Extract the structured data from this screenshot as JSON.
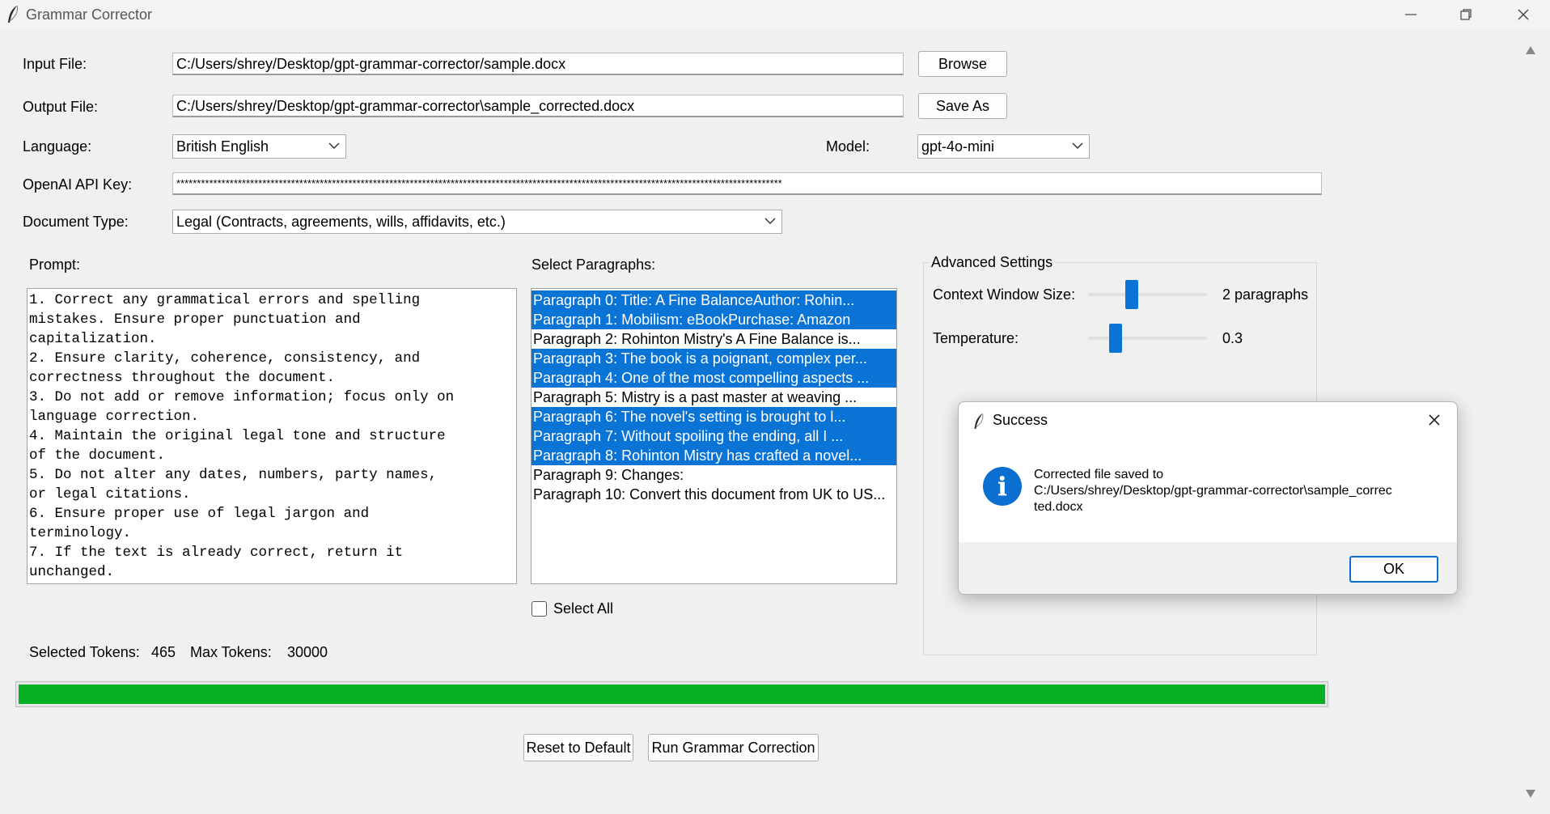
{
  "window": {
    "title": "Grammar Corrector"
  },
  "form": {
    "input_file_label": "Input File:",
    "input_file_value": "C:/Users/shrey/Desktop/gpt-grammar-corrector/sample.docx",
    "browse_label": "Browse",
    "output_file_label": "Output File:",
    "output_file_value": "C:/Users/shrey/Desktop/gpt-grammar-corrector\\sample_corrected.docx",
    "save_as_label": "Save As",
    "language_label": "Language:",
    "language_value": "British English",
    "model_label": "Model:",
    "model_value": "gpt-4o-mini",
    "api_key_label": "OpenAI API Key:",
    "api_key_value": "****************************************************************************************************************************************************",
    "doc_type_label": "Document Type:",
    "doc_type_value": "Legal (Contracts, agreements, wills, affidavits, etc.)"
  },
  "prompt": {
    "label": "Prompt:",
    "text": "1. Correct any grammatical errors and spelling\nmistakes. Ensure proper punctuation and\ncapitalization.\n2. Ensure clarity, coherence, consistency, and\ncorrectness throughout the document.\n3. Do not add or remove information; focus only on\nlanguage correction.\n4. Maintain the original legal tone and structure\nof the document.\n5. Do not alter any dates, numbers, party names,\nor legal citations.\n6. Ensure proper use of legal jargon and\nterminology.\n7. If the text is already correct, return it\nunchanged."
  },
  "paragraphs": {
    "label": "Select Paragraphs:",
    "items": [
      {
        "text": "Paragraph 0: Title: A Fine BalanceAuthor: Rohin...",
        "selected": true
      },
      {
        "text": "Paragraph 1: Mobilism: eBookPurchase: Amazon",
        "selected": true
      },
      {
        "text": "Paragraph 2: Rohinton Mistry's A Fine Balance is...",
        "selected": false
      },
      {
        "text": "Paragraph 3: The book is a poignant, complex per...",
        "selected": true
      },
      {
        "text": "Paragraph 4: One of the most compelling aspects ...",
        "selected": true
      },
      {
        "text": "Paragraph 5: Mistry is a past master at weaving ...",
        "selected": false
      },
      {
        "text": "Paragraph 6: The novel's setting is brought to l...",
        "selected": true
      },
      {
        "text": "Paragraph 7: Without spoiling the ending, all I ...",
        "selected": true
      },
      {
        "text": "Paragraph 8: Rohinton Mistry has crafted a novel...",
        "selected": true
      },
      {
        "text": "Paragraph 9: Changes:",
        "selected": false
      },
      {
        "text": "Paragraph 10: Convert this document from UK to US...",
        "selected": false
      }
    ],
    "select_all_label": "Select All",
    "select_all_checked": false
  },
  "advanced": {
    "title": "Advanced Settings",
    "context_label": "Context Window Size:",
    "context_value": "2 paragraphs",
    "context_fraction": 0.35,
    "temperature_label": "Temperature:",
    "temperature_value": "0.3",
    "temperature_fraction": 0.2
  },
  "tokens": {
    "selected_label": "Selected Tokens:",
    "selected_value": "465",
    "max_label": "Max Tokens:",
    "max_value": "30000"
  },
  "progress": {
    "percent": 100,
    "color": "#06b025"
  },
  "actions": {
    "reset_label": "Reset to Default",
    "run_label": "Run Grammar Correction"
  },
  "dialog": {
    "title": "Success",
    "message_line1": "Corrected file saved to",
    "message_line2": "C:/Users/shrey/Desktop/gpt-grammar-corrector\\sample_correc",
    "message_line3": "ted.docx",
    "ok_label": "OK",
    "icon": "info-icon"
  },
  "colors": {
    "accent": "#0a74d6",
    "progress": "#06b025"
  }
}
